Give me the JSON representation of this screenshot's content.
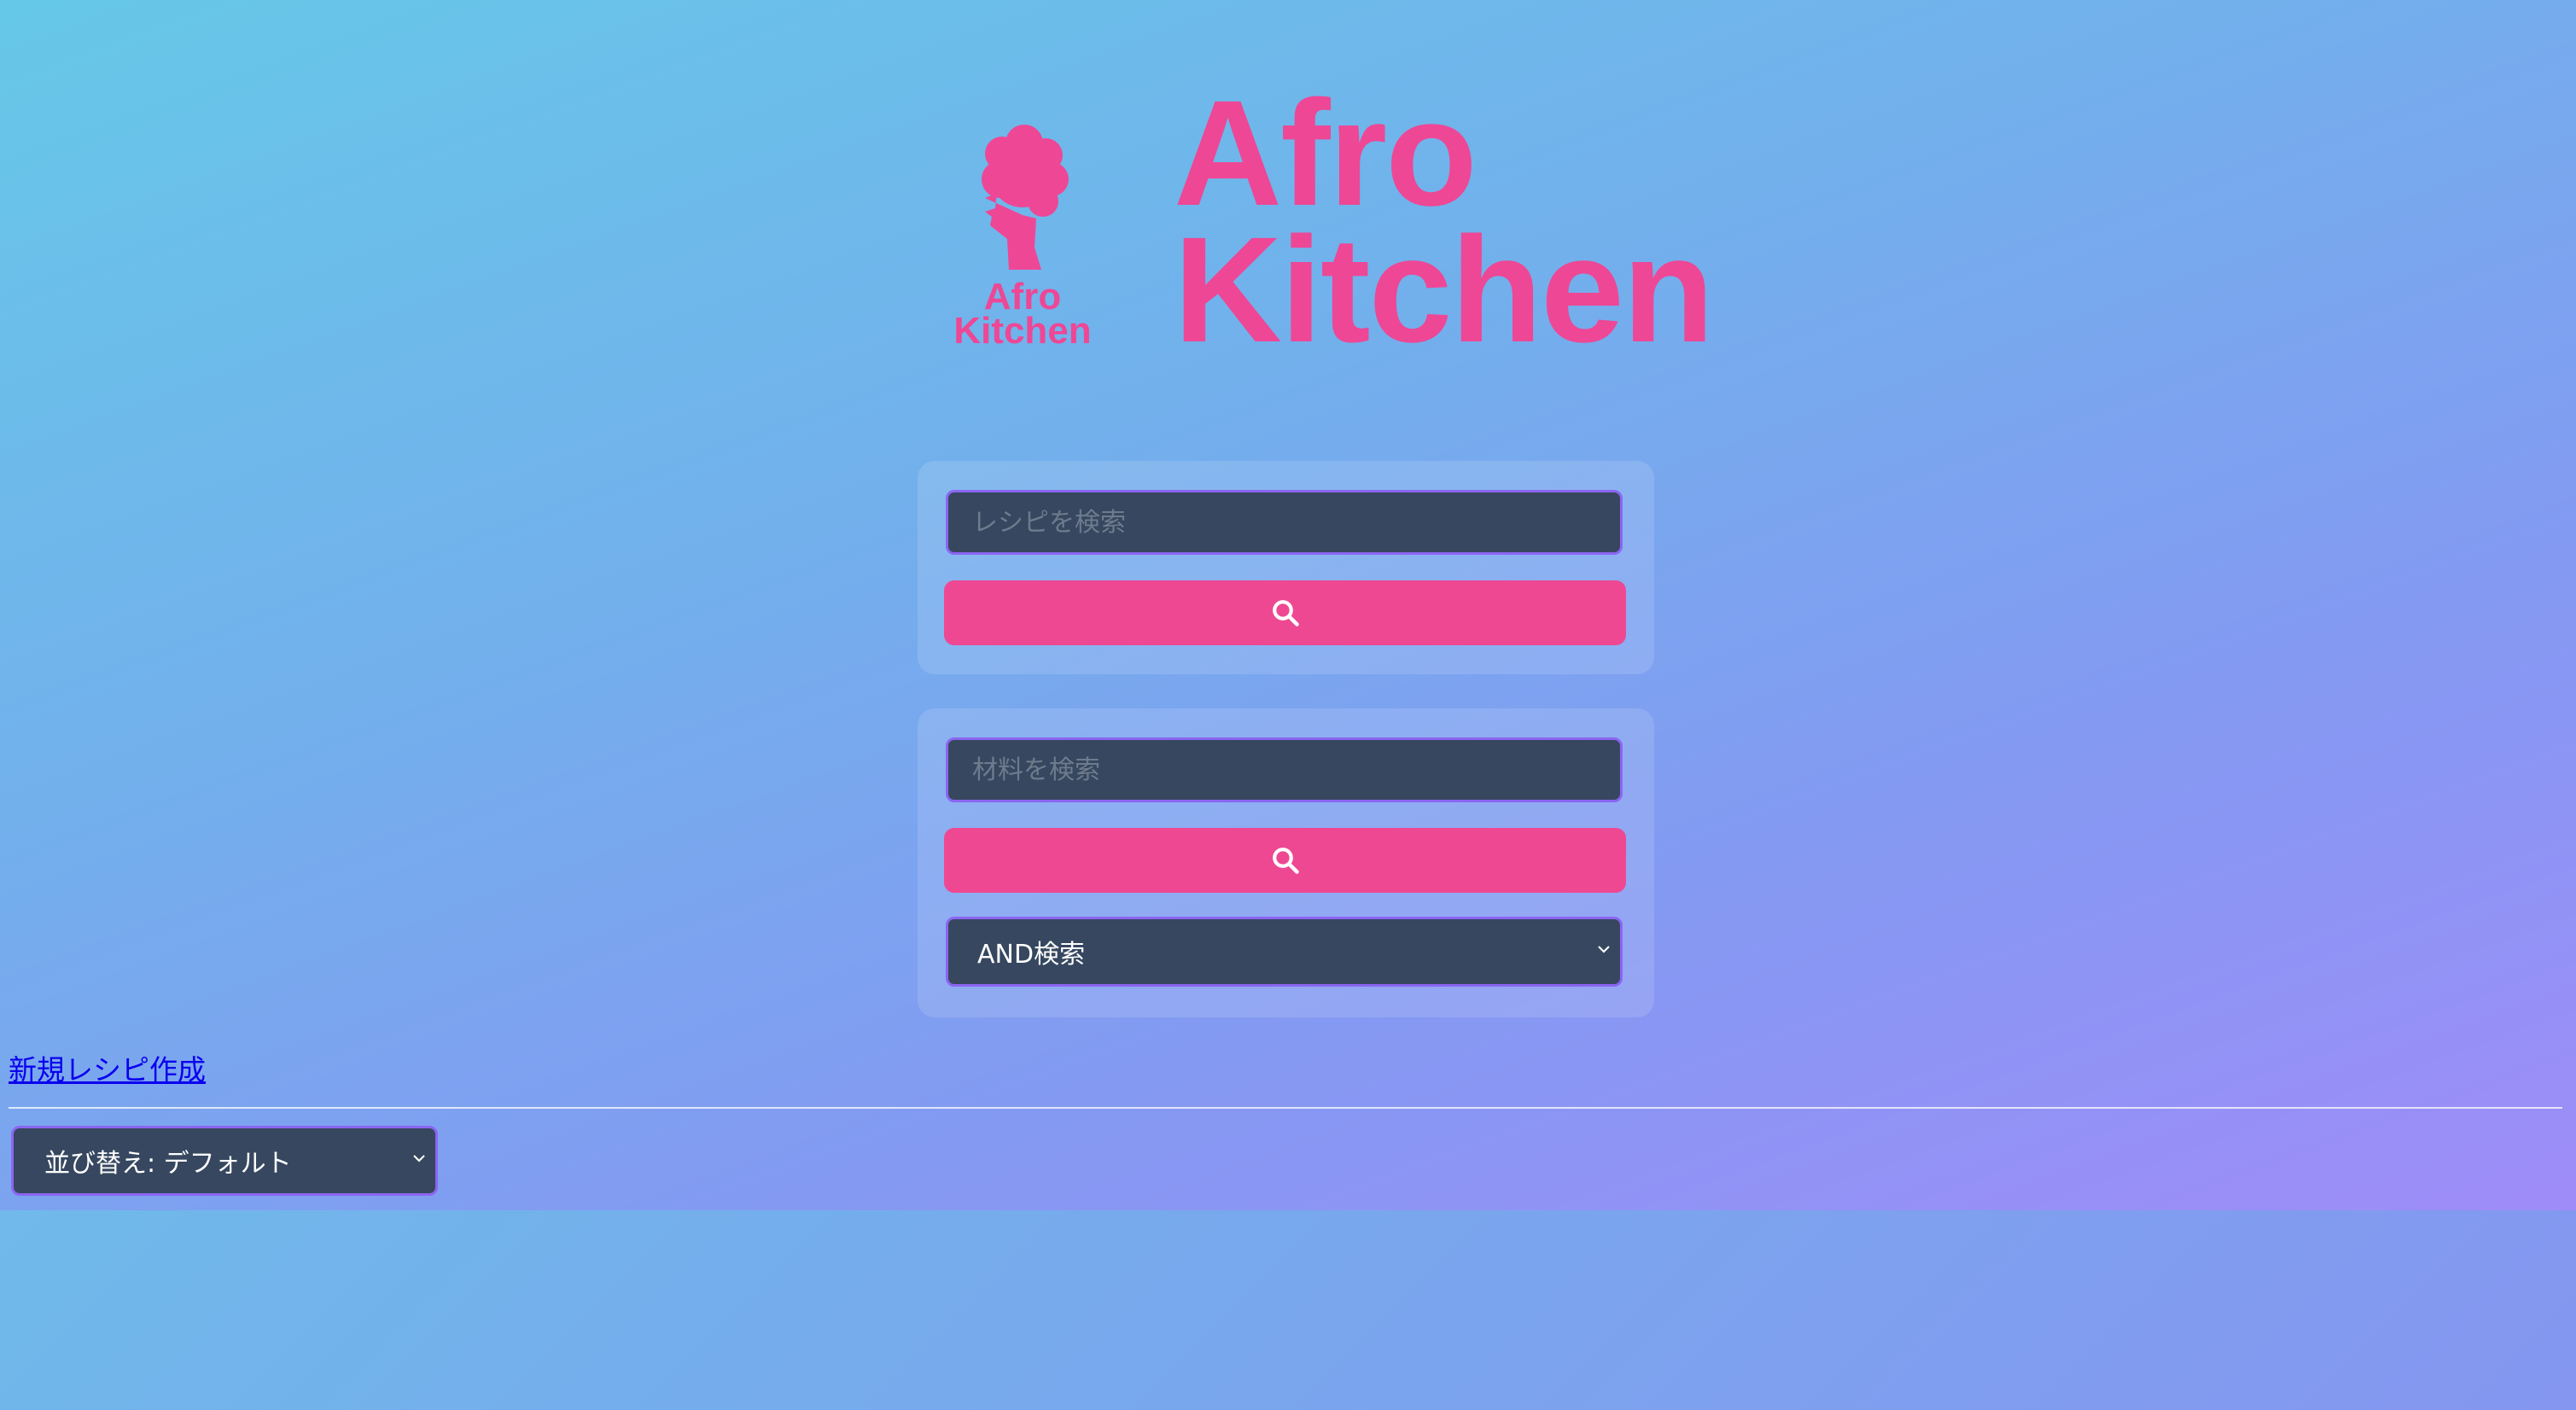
{
  "brand": {
    "name_line1": "Afro",
    "name_line2": "Kitchen",
    "logo_line1": "Afro",
    "logo_line2": "Kitchen",
    "accent_color": "#ee4795"
  },
  "recipe_search": {
    "placeholder": "レシピを検索",
    "button_icon": "search-icon"
  },
  "ingredient_search": {
    "placeholder": "材料を検索",
    "button_icon": "search-icon",
    "mode_selected": "AND検索"
  },
  "new_recipe_link": "新規レシピ作成",
  "sort": {
    "selected": "並び替え: デフォルト"
  }
}
